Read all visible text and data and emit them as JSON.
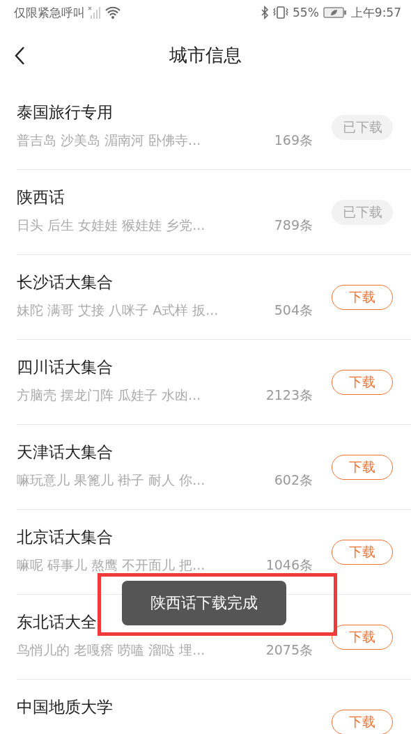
{
  "status_bar": {
    "carrier": "仅限紧急呼叫",
    "battery": "55%",
    "time": "上午9:57"
  },
  "header": {
    "title": "城市信息"
  },
  "items": [
    {
      "title": "泰国旅行专用",
      "description": "普吉岛 沙美岛 湄南河 卧佛寺...",
      "count": "169条",
      "button": "已下载",
      "downloaded": true
    },
    {
      "title": "陕西话",
      "description": "日头 后生 女娃娃 猴娃娃 乡党...",
      "count": "789条",
      "button": "已下载",
      "downloaded": true
    },
    {
      "title": "长沙话大集合",
      "description": "妹陀 满哥 艾接 八咪子 A式样 扳...",
      "count": "504条",
      "button": "下载",
      "downloaded": false
    },
    {
      "title": "四川话大集合",
      "description": "方脑壳 摆龙门阵 瓜娃子 水凼...",
      "count": "2123条",
      "button": "下载",
      "downloaded": false
    },
    {
      "title": "天津话大集合",
      "description": "嘛玩意儿 果篦儿 褂子 耐人 你...",
      "count": "602条",
      "button": "下载",
      "downloaded": false
    },
    {
      "title": "北京话大集合",
      "description": "嘛呢 碍事儿 熬鹰 不开面儿 把...",
      "count": "1046条",
      "button": "下载",
      "downloaded": false
    },
    {
      "title": "东北话大全",
      "description": "鸟悄儿的 老嘎瘩 唠嗑 溜哒 埋...",
      "count": "2075条",
      "button": "下载",
      "downloaded": false
    },
    {
      "title": "中国地质大学",
      "button": "下载",
      "downloaded": false
    }
  ],
  "toast": {
    "text": "陕西话下载完成"
  }
}
